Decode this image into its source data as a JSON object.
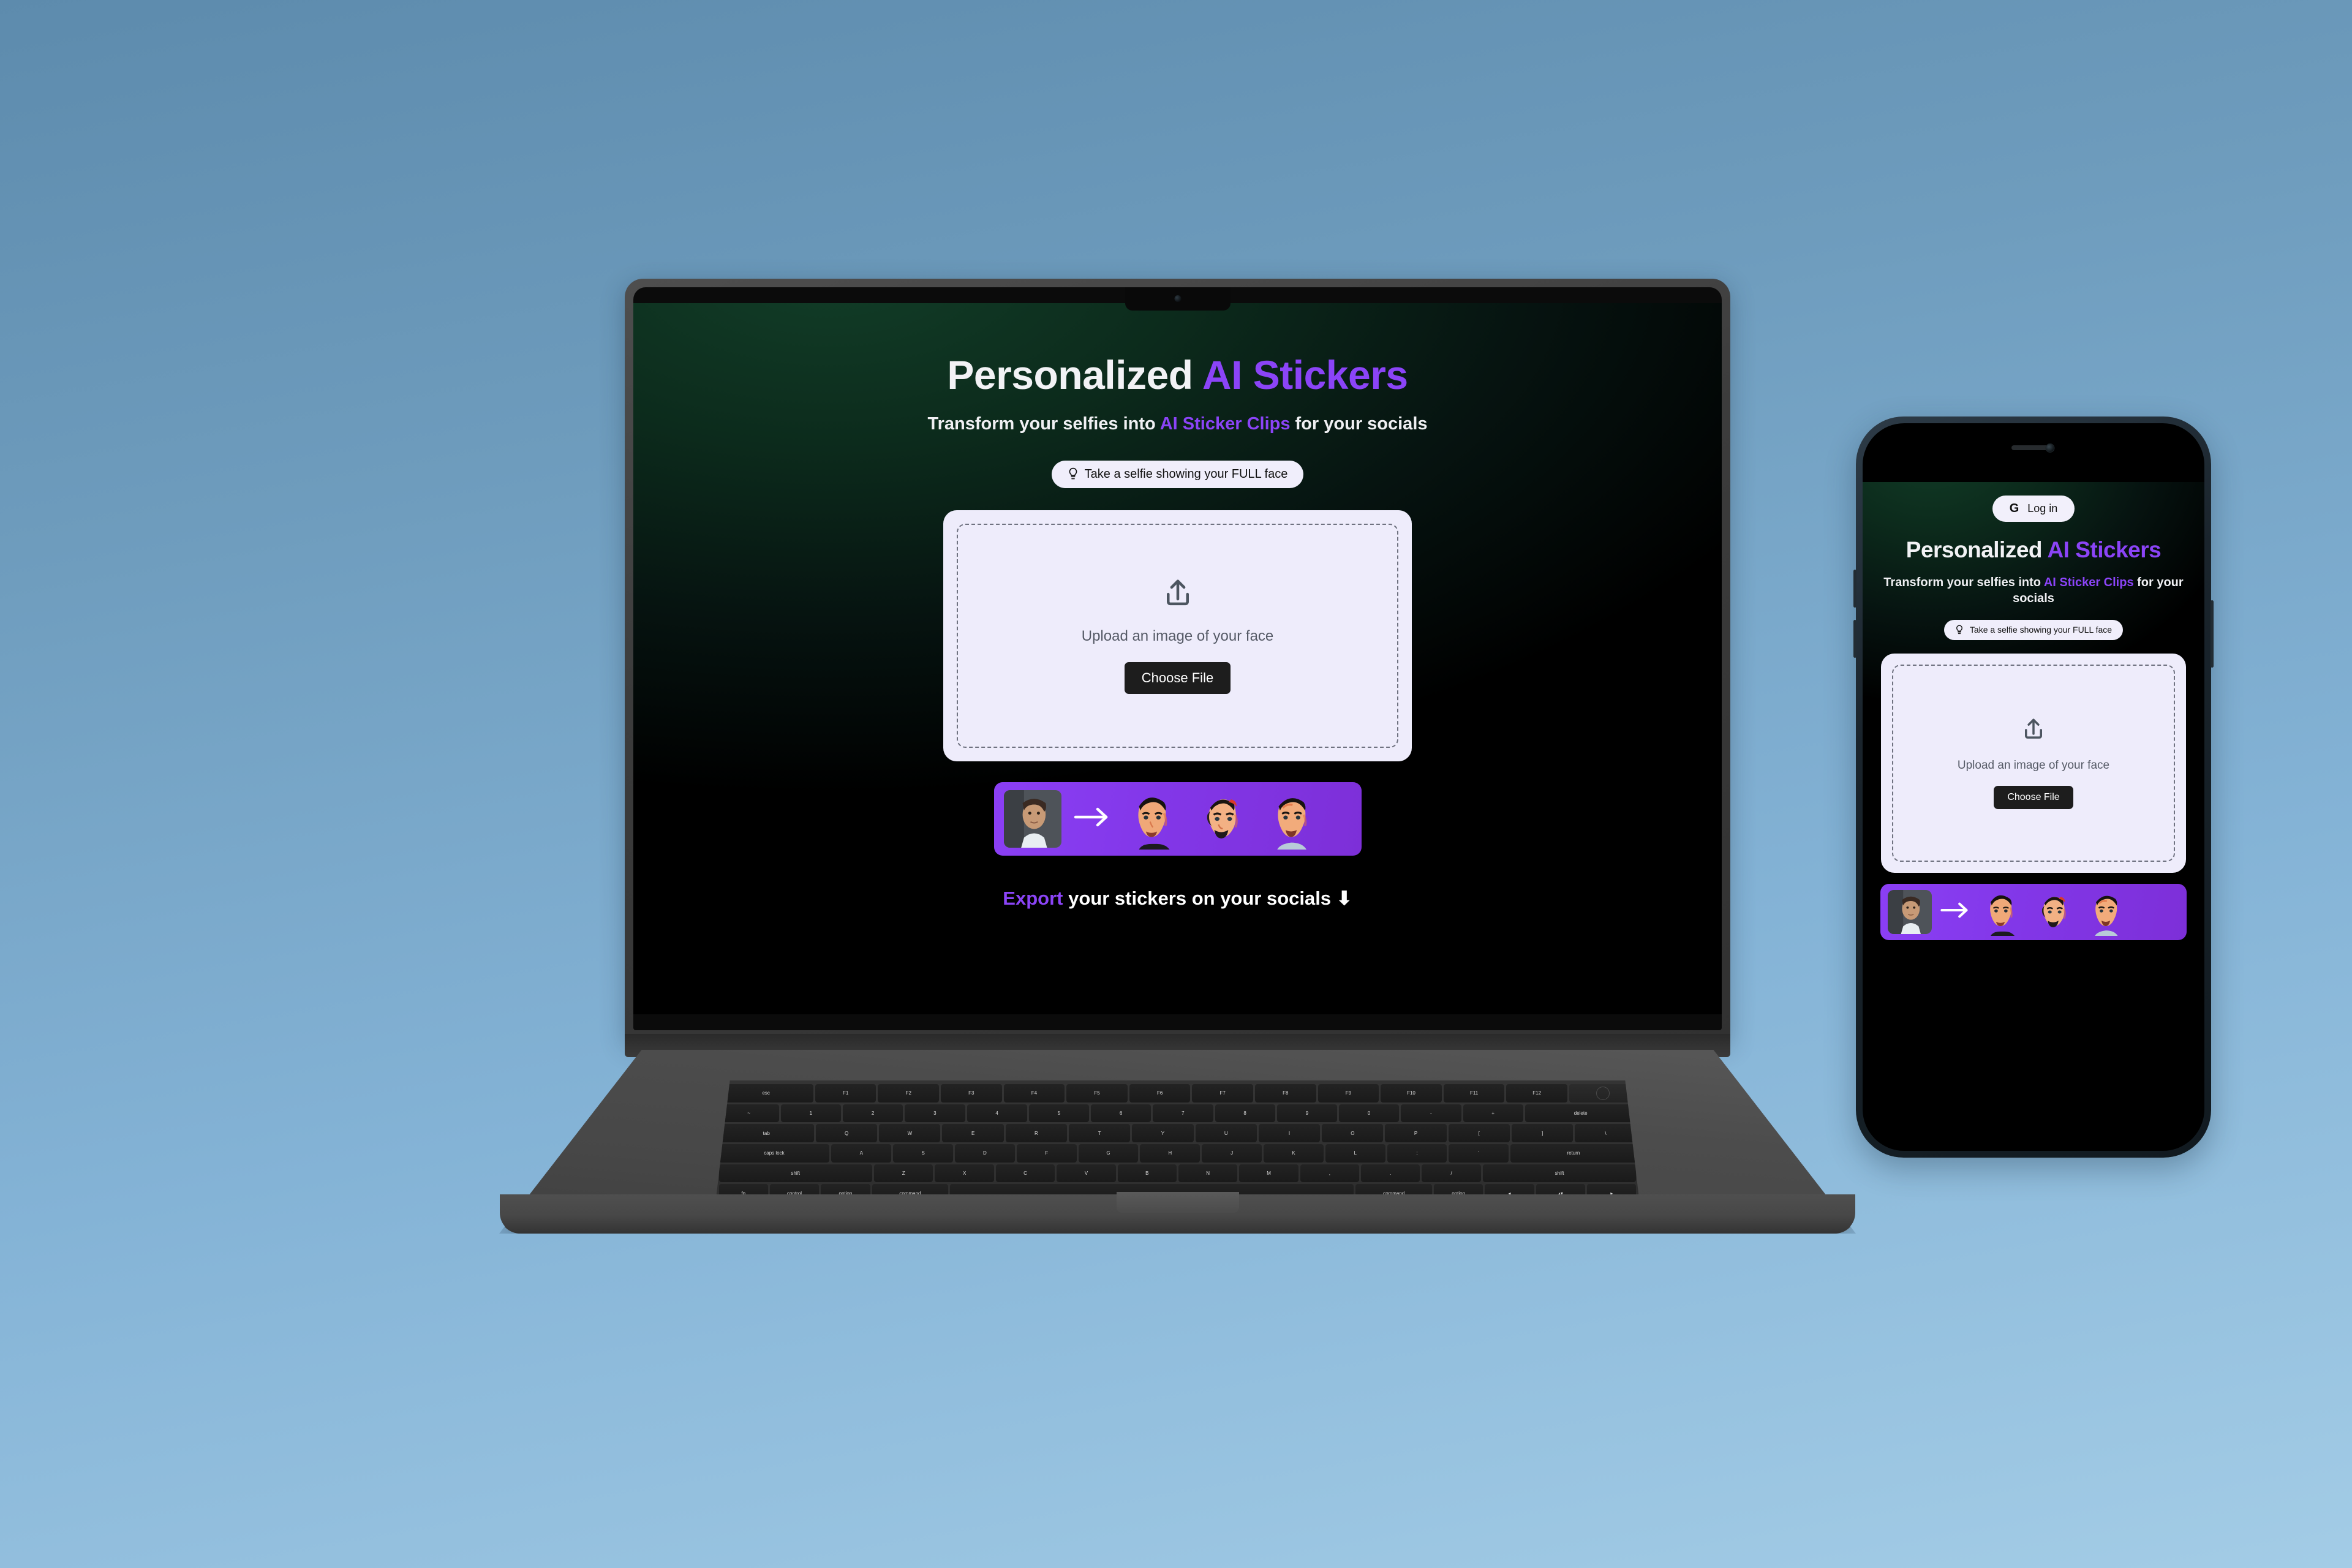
{
  "background": {
    "top_color": "#5d8bad",
    "bottom_color": "#a3cce6"
  },
  "theme": {
    "accent_purple": "#8b44f7",
    "strip_purple": "#8b3ff5",
    "card_bg": "#eeecfb",
    "screen_glow_green": "#123e28",
    "screen_bg": "#000000",
    "button_dark": "#1d1d1d"
  },
  "site": {
    "hero": {
      "title_plain": "Personalized ",
      "title_accent": "AI Stickers",
      "sub_before": "Transform your selfies into ",
      "sub_accent": "AI Sticker Clips",
      "sub_after": " for your socials"
    },
    "tip": {
      "icon": "lightbulb-icon",
      "text": "Take a selfie showing your FULL face"
    },
    "upload": {
      "icon": "upload-tray-icon",
      "label": "Upload an image of your face",
      "button_label": "Choose File"
    },
    "example_strip": {
      "icon": "arrow-right-icon",
      "source_alt": "selfie-thumbnail",
      "stickers": [
        "sticker-face-1",
        "sticker-face-2",
        "sticker-face-3"
      ]
    },
    "export": {
      "accent_word": "Export",
      "rest": " your stickers on your socials ",
      "arrow": "⬇"
    },
    "login": {
      "provider_icon": "google-g-icon",
      "provider_mark": "G",
      "label": "Log in"
    }
  },
  "devices": {
    "laptop": {
      "name": "macbook-pro-mockup"
    },
    "phone": {
      "name": "smartphone-mockup"
    }
  },
  "keyboard": {
    "fn_row": [
      "esc",
      "F1",
      "F2",
      "F3",
      "F4",
      "F5",
      "F6",
      "F7",
      "F8",
      "F9",
      "F10",
      "F11",
      "F12"
    ],
    "num_row": [
      "~",
      "1",
      "2",
      "3",
      "4",
      "5",
      "6",
      "7",
      "8",
      "9",
      "0",
      "-",
      "+",
      "delete"
    ],
    "top_row": [
      "tab",
      "Q",
      "W",
      "E",
      "R",
      "T",
      "Y",
      "U",
      "I",
      "O",
      "P",
      "[",
      "]",
      "\\"
    ],
    "home_row": [
      "caps lock",
      "A",
      "S",
      "D",
      "F",
      "G",
      "H",
      "J",
      "K",
      "L",
      ";",
      "'",
      "return"
    ],
    "bottom_row": [
      "shift",
      "Z",
      "X",
      "C",
      "V",
      "B",
      "N",
      "M",
      ",",
      ".",
      "/",
      "shift"
    ],
    "mod_row": [
      "fn",
      "control",
      "option",
      "command",
      "",
      "command",
      "option"
    ]
  }
}
